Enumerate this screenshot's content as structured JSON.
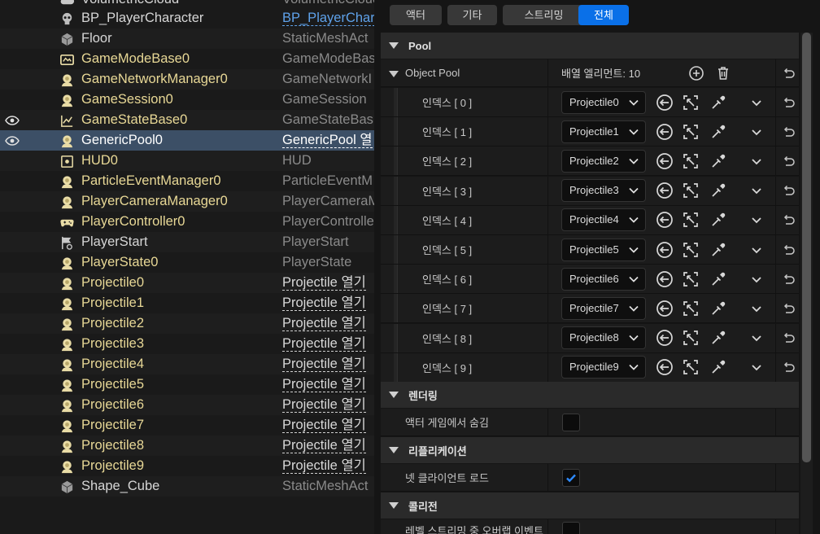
{
  "outliner": {
    "top_partial_label": "VolumetricCloud",
    "top_partial_type": "VolumetricCloud",
    "rows": [
      {
        "label": "BP_PlayerCharacter",
        "type": "BP_PlayerChar",
        "icon": "skull-icon",
        "style": "white",
        "type_style": "blue",
        "vis": false
      },
      {
        "label": "Floor",
        "type": "StaticMeshAct",
        "icon": "cube-icon",
        "style": "white",
        "type_style": "plain",
        "vis": false
      },
      {
        "label": "GameModeBase0",
        "type": "GameModeBas",
        "icon": "gamemode-icon",
        "style": "gold",
        "type_style": "plain",
        "vis": false
      },
      {
        "label": "GameNetworkManager0",
        "type": "GameNetworkI",
        "icon": "actor-icon",
        "style": "gold",
        "type_style": "plain",
        "vis": false
      },
      {
        "label": "GameSession0",
        "type": "GameSession",
        "icon": "actor-icon",
        "style": "gold",
        "type_style": "plain",
        "vis": false
      },
      {
        "label": "GameStateBase0",
        "type": "GameStateBas",
        "icon": "chart-icon",
        "style": "gold",
        "type_style": "plain",
        "vis": true
      },
      {
        "label": "GenericPool0",
        "type": "GenericPool 열",
        "icon": "actor-icon",
        "style": "gold",
        "type_style": "link",
        "vis": true,
        "selected": true
      },
      {
        "label": "HUD0",
        "type": "HUD",
        "icon": "hud-icon",
        "style": "gold",
        "type_style": "plain",
        "vis": false
      },
      {
        "label": "ParticleEventManager0",
        "type": "ParticleEventM",
        "icon": "actor-icon",
        "style": "gold",
        "type_style": "plain",
        "vis": false
      },
      {
        "label": "PlayerCameraManager0",
        "type": "PlayerCameraM",
        "icon": "actor-icon",
        "style": "gold",
        "type_style": "plain",
        "vis": false
      },
      {
        "label": "PlayerController0",
        "type": "PlayerControlle",
        "icon": "gamepad-icon",
        "style": "gold",
        "type_style": "plain",
        "vis": false
      },
      {
        "label": "PlayerStart",
        "type": "PlayerStart",
        "icon": "flag-icon",
        "style": "white",
        "type_style": "plain",
        "vis": false
      },
      {
        "label": "PlayerState0",
        "type": "PlayerState",
        "icon": "actor-icon",
        "style": "gold",
        "type_style": "plain",
        "vis": false
      },
      {
        "label": "Projectile0",
        "type": "Projectile 열기",
        "icon": "actor-icon",
        "style": "gold",
        "type_style": "link",
        "vis": false
      },
      {
        "label": "Projectile1",
        "type": "Projectile 열기",
        "icon": "actor-icon",
        "style": "gold",
        "type_style": "link",
        "vis": false
      },
      {
        "label": "Projectile2",
        "type": "Projectile 열기",
        "icon": "actor-icon",
        "style": "gold",
        "type_style": "link",
        "vis": false
      },
      {
        "label": "Projectile3",
        "type": "Projectile 열기",
        "icon": "actor-icon",
        "style": "gold",
        "type_style": "link",
        "vis": false
      },
      {
        "label": "Projectile4",
        "type": "Projectile 열기",
        "icon": "actor-icon",
        "style": "gold",
        "type_style": "link",
        "vis": false
      },
      {
        "label": "Projectile5",
        "type": "Projectile 열기",
        "icon": "actor-icon",
        "style": "gold",
        "type_style": "link",
        "vis": false
      },
      {
        "label": "Projectile6",
        "type": "Projectile 열기",
        "icon": "actor-icon",
        "style": "gold",
        "type_style": "link",
        "vis": false
      },
      {
        "label": "Projectile7",
        "type": "Projectile 열기",
        "icon": "actor-icon",
        "style": "gold",
        "type_style": "link",
        "vis": false
      },
      {
        "label": "Projectile8",
        "type": "Projectile 열기",
        "icon": "actor-icon",
        "style": "gold",
        "type_style": "link",
        "vis": false
      },
      {
        "label": "Projectile9",
        "type": "Projectile 열기",
        "icon": "actor-icon",
        "style": "gold",
        "type_style": "link",
        "vis": false
      },
      {
        "label": "Shape_Cube",
        "type": "StaticMeshAct",
        "icon": "cube-icon",
        "style": "white",
        "type_style": "plain",
        "vis": false
      }
    ]
  },
  "details": {
    "filters": [
      {
        "label": "액터",
        "active": false
      },
      {
        "label": "기타",
        "active": false
      },
      {
        "label": "스트리밍",
        "active": false
      },
      {
        "label": "전체",
        "active": true
      }
    ],
    "pool_category": "Pool",
    "object_pool_label": "Object Pool",
    "array_summary": "배열 엘리먼트: 10",
    "elements": [
      {
        "index_label": "인덱스 [ 0 ]",
        "value": "Projectile0"
      },
      {
        "index_label": "인덱스 [ 1 ]",
        "value": "Projectile1"
      },
      {
        "index_label": "인덱스 [ 2 ]",
        "value": "Projectile2"
      },
      {
        "index_label": "인덱스 [ 3 ]",
        "value": "Projectile3"
      },
      {
        "index_label": "인덱스 [ 4 ]",
        "value": "Projectile4"
      },
      {
        "index_label": "인덱스 [ 5 ]",
        "value": "Projectile5"
      },
      {
        "index_label": "인덱스 [ 6 ]",
        "value": "Projectile6"
      },
      {
        "index_label": "인덱스 [ 7 ]",
        "value": "Projectile7"
      },
      {
        "index_label": "인덱스 [ 8 ]",
        "value": "Projectile8"
      },
      {
        "index_label": "인덱스 [ 9 ]",
        "value": "Projectile9"
      }
    ],
    "rendering_category": "렌더링",
    "hide_in_game_label": "액터 게임에서 숨김",
    "hide_in_game_checked": false,
    "replication_category": "리플리케이션",
    "net_load_client_label": "넷 클라이언트 로드",
    "net_load_client_checked": true,
    "collision_category": "콜리전",
    "level_streaming_partial_label": "레벨 스트리밍 중 오버랩 이벤트"
  },
  "colors": {
    "accent": "#0a70e8",
    "selection": "#3c4f66",
    "actor_label": "#e8d896",
    "link_blue": "#5fa2ea"
  }
}
